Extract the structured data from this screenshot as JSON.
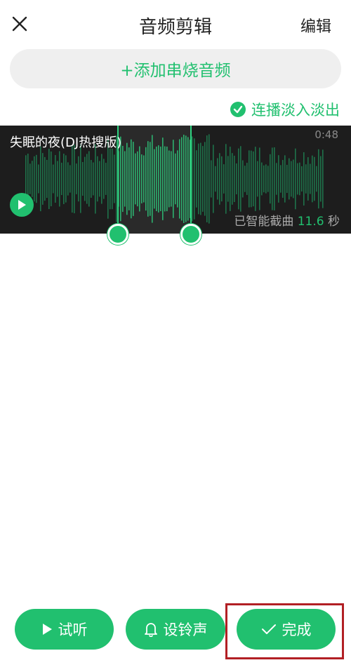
{
  "header": {
    "close_icon": "close-icon",
    "title": "音频剪辑",
    "edit_label": "编辑"
  },
  "add_medley": {
    "label": "+添加串烧音频"
  },
  "fade_toggle": {
    "label": "连播淡入淡出",
    "checked": true
  },
  "track": {
    "name": "失眠的夜(DJ热搜版)",
    "duration": "0:48",
    "smart_prefix": "已智能截曲",
    "smart_value": "11.6",
    "smart_unit": "秒",
    "selection_start_fraction": 0.335,
    "selection_end_fraction": 0.543
  },
  "footer": {
    "preview_label": "试听",
    "ringtone_label": "设铃声",
    "done_label": "完成"
  },
  "colors": {
    "accent": "#21c06f",
    "wave_bg": "#1d1d1d",
    "highlight_box": "#b21f24"
  }
}
